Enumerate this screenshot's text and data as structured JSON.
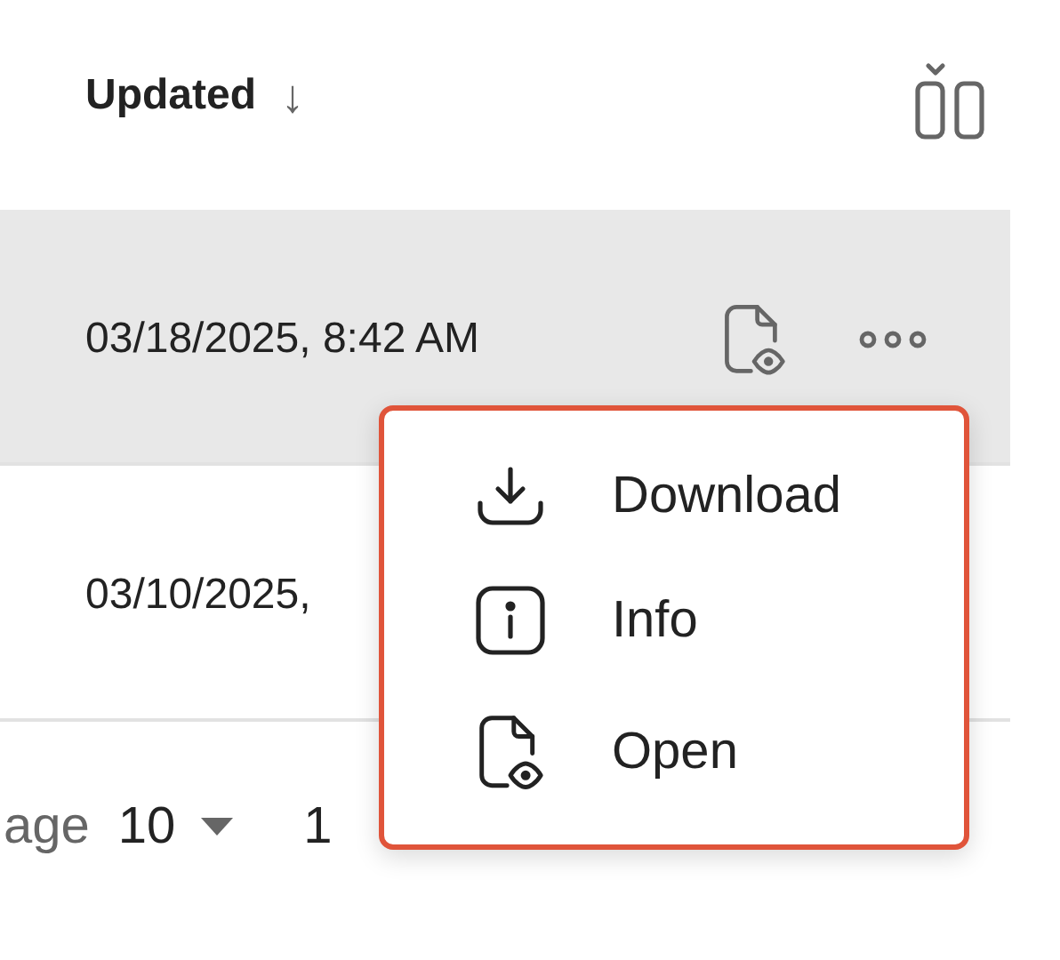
{
  "header": {
    "sort_column": "Updated",
    "sort_arrow": "↓"
  },
  "rows": [
    {
      "updated": "03/18/2025, 8:42 AM",
      "selected": true
    },
    {
      "updated": "03/10/2025,",
      "selected": false
    }
  ],
  "pagination": {
    "label": "age",
    "page_size": "10",
    "range": "1"
  },
  "menu": {
    "items": [
      {
        "kind": "download",
        "label": "Download"
      },
      {
        "kind": "info",
        "label": "Info"
      },
      {
        "kind": "open",
        "label": "Open"
      }
    ]
  }
}
